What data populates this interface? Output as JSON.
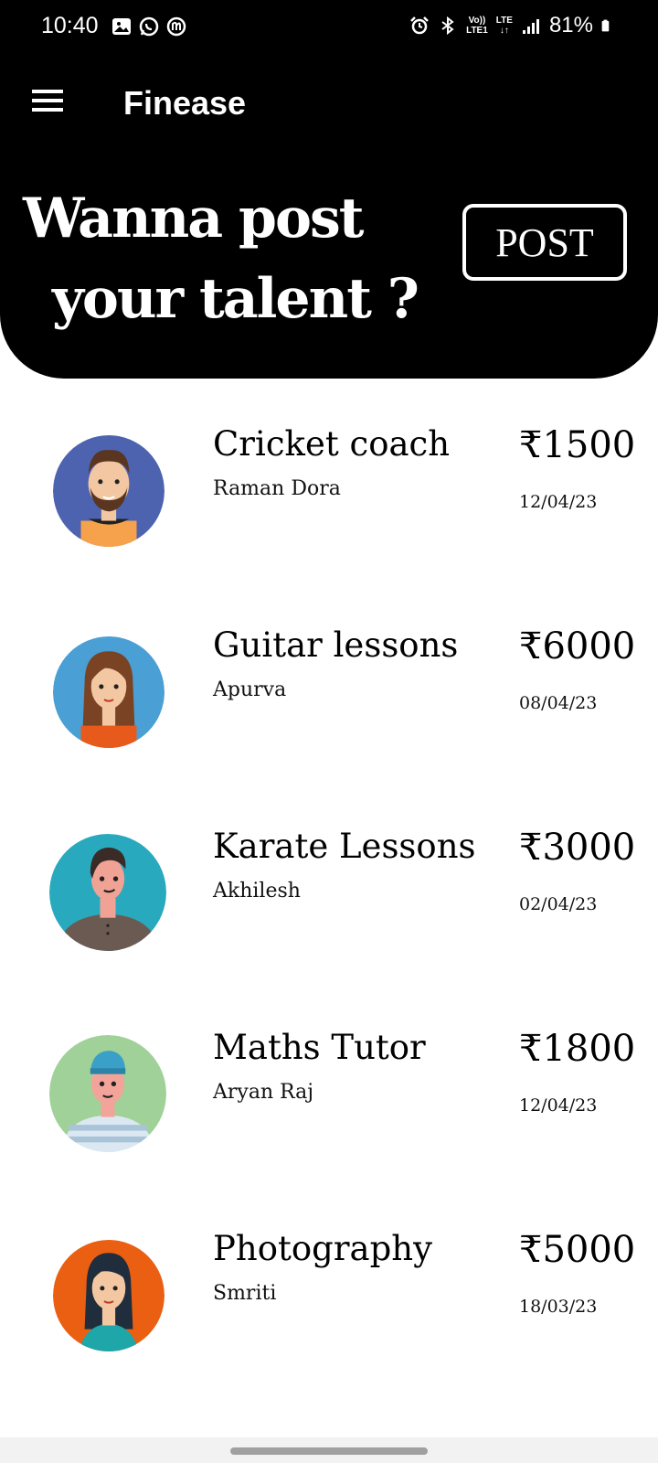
{
  "status_bar": {
    "time": "10:40",
    "battery": "81%",
    "network_top": "Vo))",
    "network_bottom": "LTE1",
    "lte_label": "LTE"
  },
  "app_bar": {
    "title": "Finease",
    "menu_icon": "hamburger-menu-icon"
  },
  "banner": {
    "line1": "Wanna post",
    "line2": "your talent ?",
    "post_label": "POST"
  },
  "colors": {
    "header_bg": "#000000",
    "page_bg": "#ffffff"
  },
  "listings": [
    {
      "title": "Cricket coach",
      "name": "Raman Dora",
      "price": "₹1500",
      "date": "12/04/23",
      "avatar_color": "#4d63b0"
    },
    {
      "title": "Guitar lessons",
      "name": "Apurva",
      "price": "₹6000",
      "date": "08/04/23",
      "avatar_color": "#4a9fd5"
    },
    {
      "title": "Karate Lessons",
      "name": "Akhilesh",
      "price": "₹3000",
      "date": "02/04/23",
      "avatar_color": "#28a9bd"
    },
    {
      "title": "Maths Tutor",
      "name": "Aryan Raj",
      "price": "₹1800",
      "date": "12/04/23",
      "avatar_color": "#9fd199"
    },
    {
      "title": "Photography",
      "name": "Smriti",
      "price": "₹5000",
      "date": "18/03/23",
      "avatar_color": "#ea5f12"
    }
  ]
}
